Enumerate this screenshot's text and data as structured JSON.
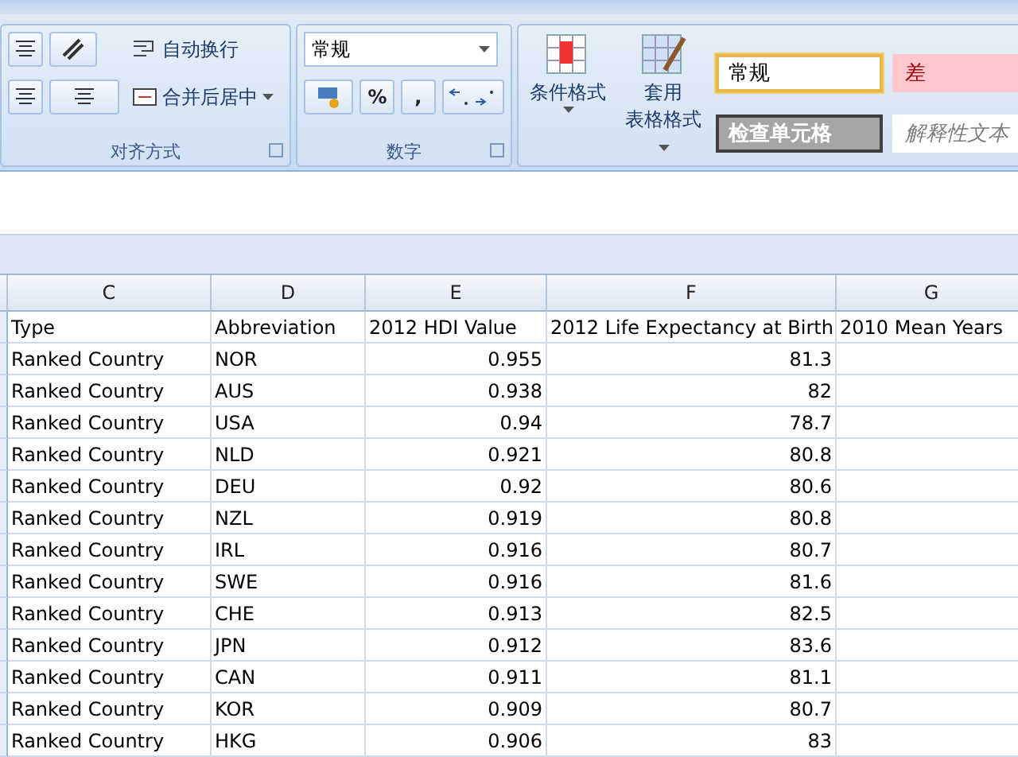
{
  "ribbon": {
    "alignment": {
      "wrap_text": "自动换行",
      "merge_center": "合并后居中",
      "label": "对齐方式"
    },
    "number": {
      "format": "常规",
      "percent": "%",
      "comma": ",",
      "label": "数字"
    },
    "styles": {
      "conditional": "条件格式",
      "table_format": [
        "套用",
        "表格格式"
      ],
      "cells": [
        {
          "label": "常规",
          "kind": "normal",
          "selected": true
        },
        {
          "label": "差",
          "kind": "bad",
          "selected": false
        },
        {
          "label": "检查单元格",
          "kind": "check",
          "selected": false
        },
        {
          "label": "解释性文本",
          "kind": "note",
          "selected": false
        }
      ]
    }
  },
  "sheet": {
    "columns": [
      "C",
      "D",
      "E",
      "F",
      "G"
    ],
    "header": [
      "Type",
      "Abbreviation",
      "2012 HDI Value",
      "2012 Life Expectancy at Birth",
      "2010 Mean Years"
    ],
    "rows": [
      [
        "Ranked Country",
        "NOR",
        "0.955",
        "81.3"
      ],
      [
        "Ranked Country",
        "AUS",
        "0.938",
        "82"
      ],
      [
        "Ranked Country",
        "USA",
        "0.94",
        "78.7"
      ],
      [
        "Ranked Country",
        "NLD",
        "0.921",
        "80.8"
      ],
      [
        "Ranked Country",
        "DEU",
        "0.92",
        "80.6"
      ],
      [
        "Ranked Country",
        "NZL",
        "0.919",
        "80.8"
      ],
      [
        "Ranked Country",
        "IRL",
        "0.916",
        "80.7"
      ],
      [
        "Ranked Country",
        "SWE",
        "0.916",
        "81.6"
      ],
      [
        "Ranked Country",
        "CHE",
        "0.913",
        "82.5"
      ],
      [
        "Ranked Country",
        "JPN",
        "0.912",
        "83.6"
      ],
      [
        "Ranked Country",
        "CAN",
        "0.911",
        "81.1"
      ],
      [
        "Ranked Country",
        "KOR",
        "0.909",
        "80.7"
      ],
      [
        "Ranked Country",
        "HKG",
        "0.906",
        "83"
      ]
    ]
  }
}
